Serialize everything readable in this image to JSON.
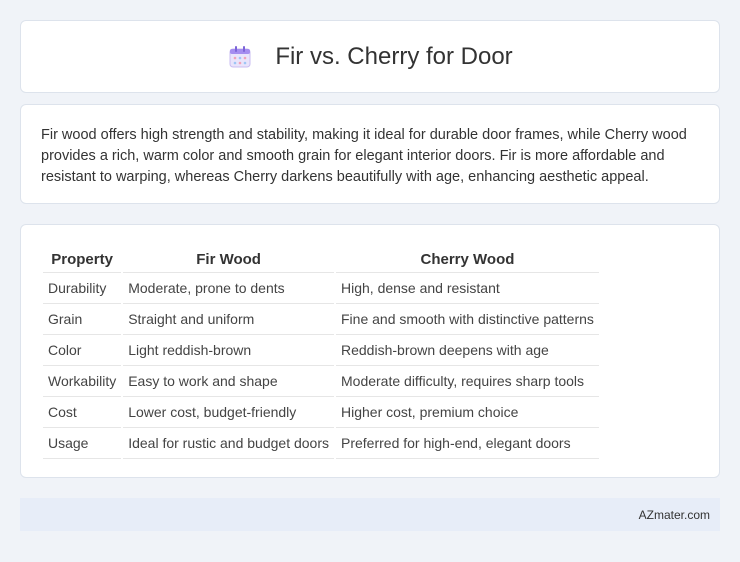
{
  "header": {
    "title": "Fir vs. Cherry for Door",
    "icon": "calendar-icon"
  },
  "summary": {
    "text": "Fir wood offers high strength and stability, making it ideal for durable door frames, while Cherry wood provides a rich, warm color and smooth grain for elegant interior doors. Fir is more affordable and resistant to warping, whereas Cherry darkens beautifully with age, enhancing aesthetic appeal."
  },
  "table": {
    "headers": [
      "Property",
      "Fir Wood",
      "Cherry Wood"
    ],
    "rows": [
      [
        "Durability",
        "Moderate, prone to dents",
        "High, dense and resistant"
      ],
      [
        "Grain",
        "Straight and uniform",
        "Fine and smooth with distinctive patterns"
      ],
      [
        "Color",
        "Light reddish-brown",
        "Reddish-brown deepens with age"
      ],
      [
        "Workability",
        "Easy to work and shape",
        "Moderate difficulty, requires sharp tools"
      ],
      [
        "Cost",
        "Lower cost, budget-friendly",
        "Higher cost, premium choice"
      ],
      [
        "Usage",
        "Ideal for rustic and budget doors",
        "Preferred for high-end, elegant doors"
      ]
    ]
  },
  "footer": {
    "text": "AZmater.com"
  }
}
